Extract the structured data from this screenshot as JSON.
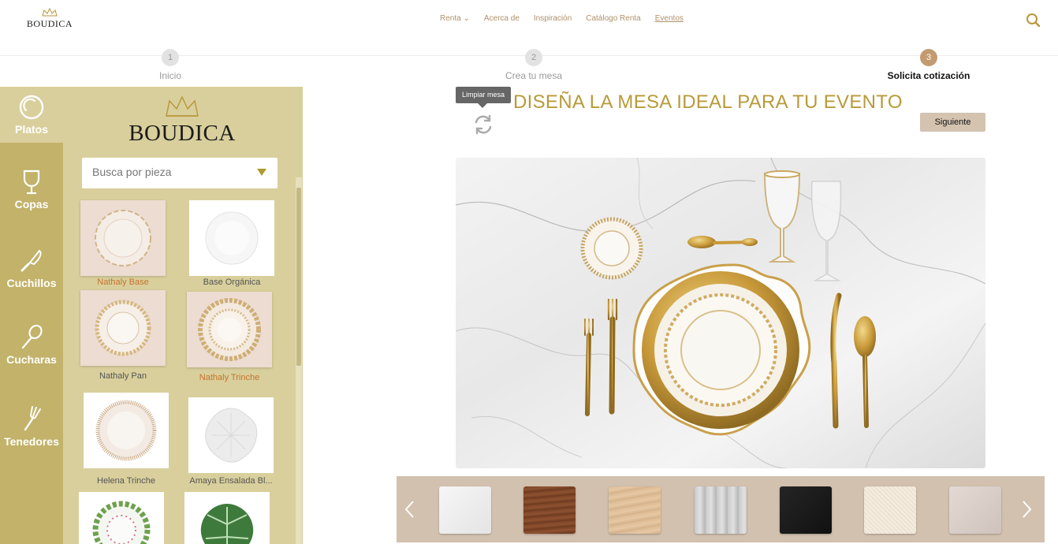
{
  "header": {
    "logo_text": "BOUDICA",
    "nav": [
      {
        "label": "Renta"
      },
      {
        "label": "Acerca de"
      },
      {
        "label": "Inspiración"
      },
      {
        "label": "Catálogo Renta"
      },
      {
        "label": "Eventos"
      }
    ],
    "search_icon": "search-icon"
  },
  "stepper": [
    {
      "num": "1",
      "label": "Inicio"
    },
    {
      "num": "2",
      "label": "Crea tu mesa"
    },
    {
      "num": "3",
      "label": "Solicita cotización"
    }
  ],
  "sidebar": {
    "categories": [
      {
        "label": "Platos",
        "icon": "plate-icon"
      },
      {
        "label": "Copas",
        "icon": "glass-icon"
      },
      {
        "label": "Cuchillos",
        "icon": "knife-icon"
      },
      {
        "label": "Cucharas",
        "icon": "spoon-icon"
      },
      {
        "label": "Tenedores",
        "icon": "fork-icon"
      }
    ]
  },
  "panel": {
    "logo_text": "BOUDICA",
    "search_placeholder": "Busca por pieza",
    "products": [
      {
        "name": "Nathaly Base"
      },
      {
        "name": "Base Orgánica"
      },
      {
        "name": "Nathaly Pan"
      },
      {
        "name": "Nathaly Trinche"
      },
      {
        "name": "Helena Trinche"
      },
      {
        "name": "Amaya Ensalada Bl..."
      }
    ]
  },
  "main": {
    "clear_tooltip": "Limpiar mesa",
    "title": "DISEÑA LA MESA IDEAL PARA TU EVENTO",
    "next_label": "Siguiente"
  },
  "textures": {
    "colors": [
      "#eeeeee",
      "#7a4225",
      "#dcbb94",
      "#c9c9c9",
      "#1c1c1c",
      "#efe5d6",
      "#dcd0cb"
    ]
  },
  "colors": {
    "accent_gold": "#b89a3a",
    "rail": "#c2b26a",
    "panel": "#d9cf9c",
    "step_active": "#c49a70"
  }
}
